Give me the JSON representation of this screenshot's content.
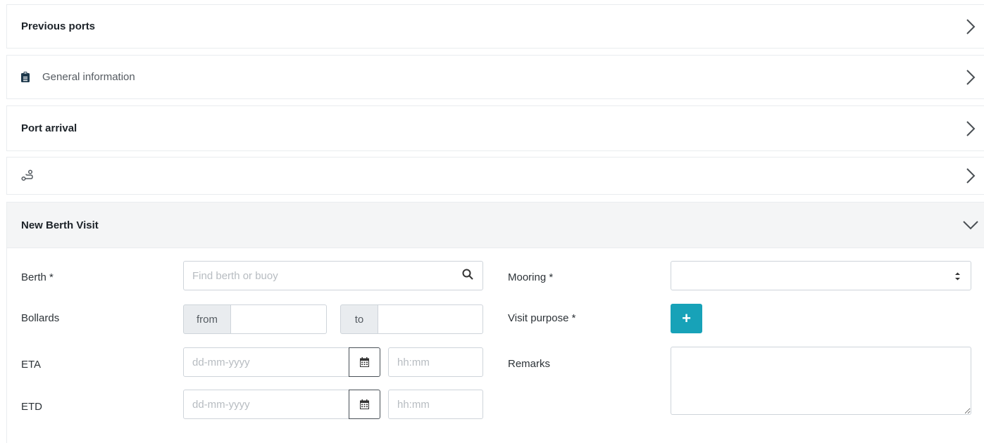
{
  "panels": {
    "previous_ports": {
      "title": "Previous ports",
      "icon": "chevron-right-icon"
    },
    "general_information": {
      "title": "General information",
      "icon": "clipboard-icon"
    },
    "port_arrival": {
      "title": "Port arrival",
      "icon": "chevron-right-icon"
    },
    "route": {
      "icon": "route-icon"
    },
    "new_berth_visit": {
      "title": "New Berth Visit",
      "icon": "chevron-down-icon"
    }
  },
  "form": {
    "berth": {
      "label": "Berth *",
      "placeholder": "Find berth or buoy",
      "value": ""
    },
    "bollards": {
      "label": "Bollards",
      "from_label": "from",
      "to_label": "to",
      "from_value": "",
      "to_value": ""
    },
    "eta": {
      "label": "ETA",
      "date_placeholder": "dd-mm-yyyy",
      "time_placeholder": "hh:mm"
    },
    "etd": {
      "label": "ETD",
      "date_placeholder": "dd-mm-yyyy",
      "time_placeholder": "hh:mm"
    },
    "mooring": {
      "label": "Mooring *",
      "value": ""
    },
    "visit_purpose": {
      "label": "Visit purpose *",
      "add_label": "+"
    },
    "remarks": {
      "label": "Remarks",
      "value": ""
    }
  },
  "colors": {
    "accent": "#17a2b8",
    "clipboard": "#1f3a4d",
    "border": "#ced4da"
  }
}
